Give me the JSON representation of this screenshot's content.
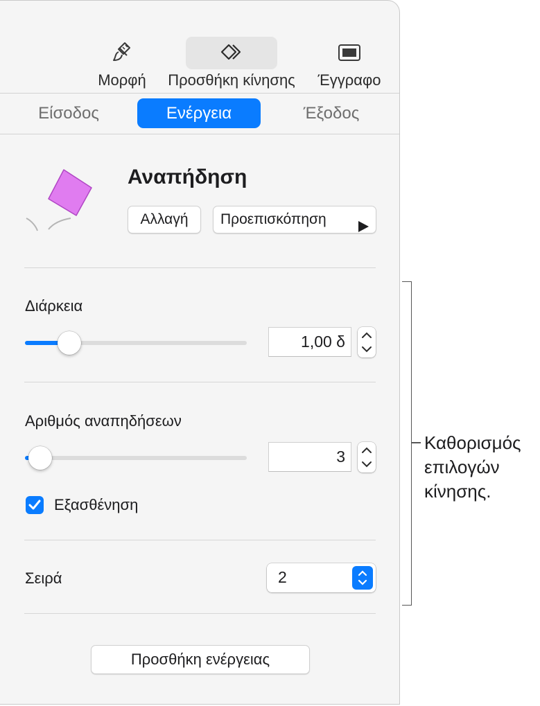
{
  "toolbar": {
    "format_label": "Μορφή",
    "animate_label": "Προσθήκη κίνησης",
    "document_label": "Έγγραφο",
    "format_icon": "paintbrush-icon",
    "animate_icon": "diamond-animate-icon",
    "document_icon": "document-icon"
  },
  "tabs": {
    "build_in": "Είσοδος",
    "action": "Ενέργεια",
    "build_out": "Έξοδος",
    "active": "Ενέργεια"
  },
  "animation": {
    "name": "Αναπήδηση",
    "change_label": "Αλλαγή",
    "preview_label": "Προεπισκόπηση",
    "preview_icon": "play-icon"
  },
  "duration": {
    "label": "Διάρκεια",
    "value": "1,00 δ",
    "slider_fraction": 0.2
  },
  "bounces": {
    "label": "Αριθμός αναπηδήσεων",
    "value": "3",
    "slider_fraction": 0.07
  },
  "fade": {
    "label": "Εξασθένηση",
    "checked": true
  },
  "order": {
    "label": "Σειρά",
    "value": "2"
  },
  "add_action_label": "Προσθήκη ενέργειας",
  "callout": {
    "line1": "Καθορισμός",
    "line2": "επιλογών",
    "line3": "κίνησης."
  },
  "colors": {
    "accent": "#0a7cff",
    "shape_fill": "#e07cf0",
    "panel_bg": "#f5f5f5"
  }
}
